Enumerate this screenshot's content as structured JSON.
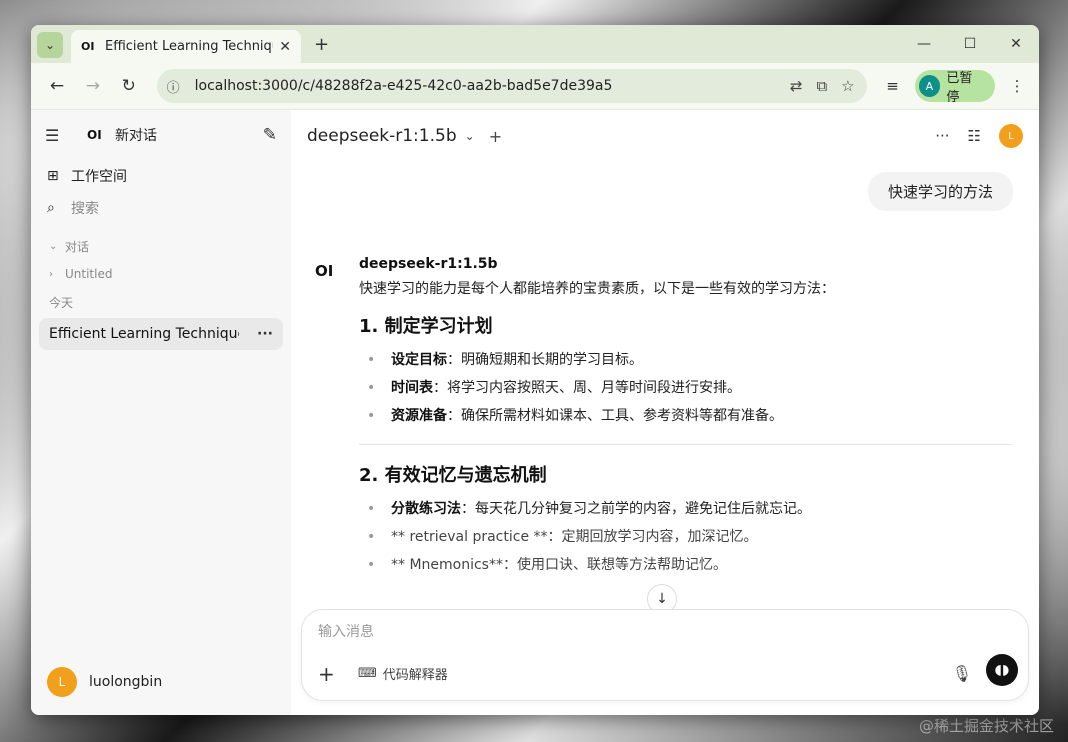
{
  "browser": {
    "tab_title": "Efficient Learning Techniques",
    "tab_favicon": "OI",
    "url": "localhost:3000/c/48288f2a-e425-42c0-aa2b-bad5e7de39a5",
    "profile_initial": "A",
    "profile_status": "已暂停"
  },
  "sidebar": {
    "logo": "OI",
    "new_chat": "新对话",
    "workspace": "工作空间",
    "search_placeholder": "搜索",
    "section_chats": "对话",
    "untitled": "Untitled",
    "section_today": "今天",
    "active_chat": "Efficient Learning Techniques",
    "user_initial": "L",
    "username": "luolongbin"
  },
  "header": {
    "model": "deepseek-r1:1.5b",
    "avatar_initial": "L"
  },
  "chat": {
    "user_message": "快速学习的方法",
    "assistant_logo": "OI",
    "assistant_model": "deepseek-r1:1.5b",
    "intro": "快速学习的能力是每个人都能培养的宝贵素质，以下是一些有效的学习方法：",
    "sections": [
      {
        "heading": "1. 制定学习计划",
        "items": [
          {
            "bold": "设定目标",
            "text": "：明确短期和长期的学习目标。"
          },
          {
            "bold": "时间表",
            "text": "：将学习内容按照天、周、月等时间段进行安排。"
          },
          {
            "bold": "资源准备",
            "text": "：确保所需材料如课本、工具、参考资料等都有准备。"
          }
        ]
      },
      {
        "heading": "2. 有效记忆与遗忘机制",
        "items": [
          {
            "bold": "分散练习法",
            "text": "：每天花几分钟复习之前学的内容，避免记住后就忘记。"
          },
          {
            "bold": "",
            "text": "** retrieval practice **：定期回放学习内容，加深记忆。"
          },
          {
            "bold": "",
            "text": "** Mnemonics**：使用口诀、联想等方法帮助记忆。"
          }
        ]
      }
    ]
  },
  "composer": {
    "placeholder": "输入消息",
    "tool_label": "代码解释器"
  },
  "watermark": "@稀土掘金技术社区"
}
